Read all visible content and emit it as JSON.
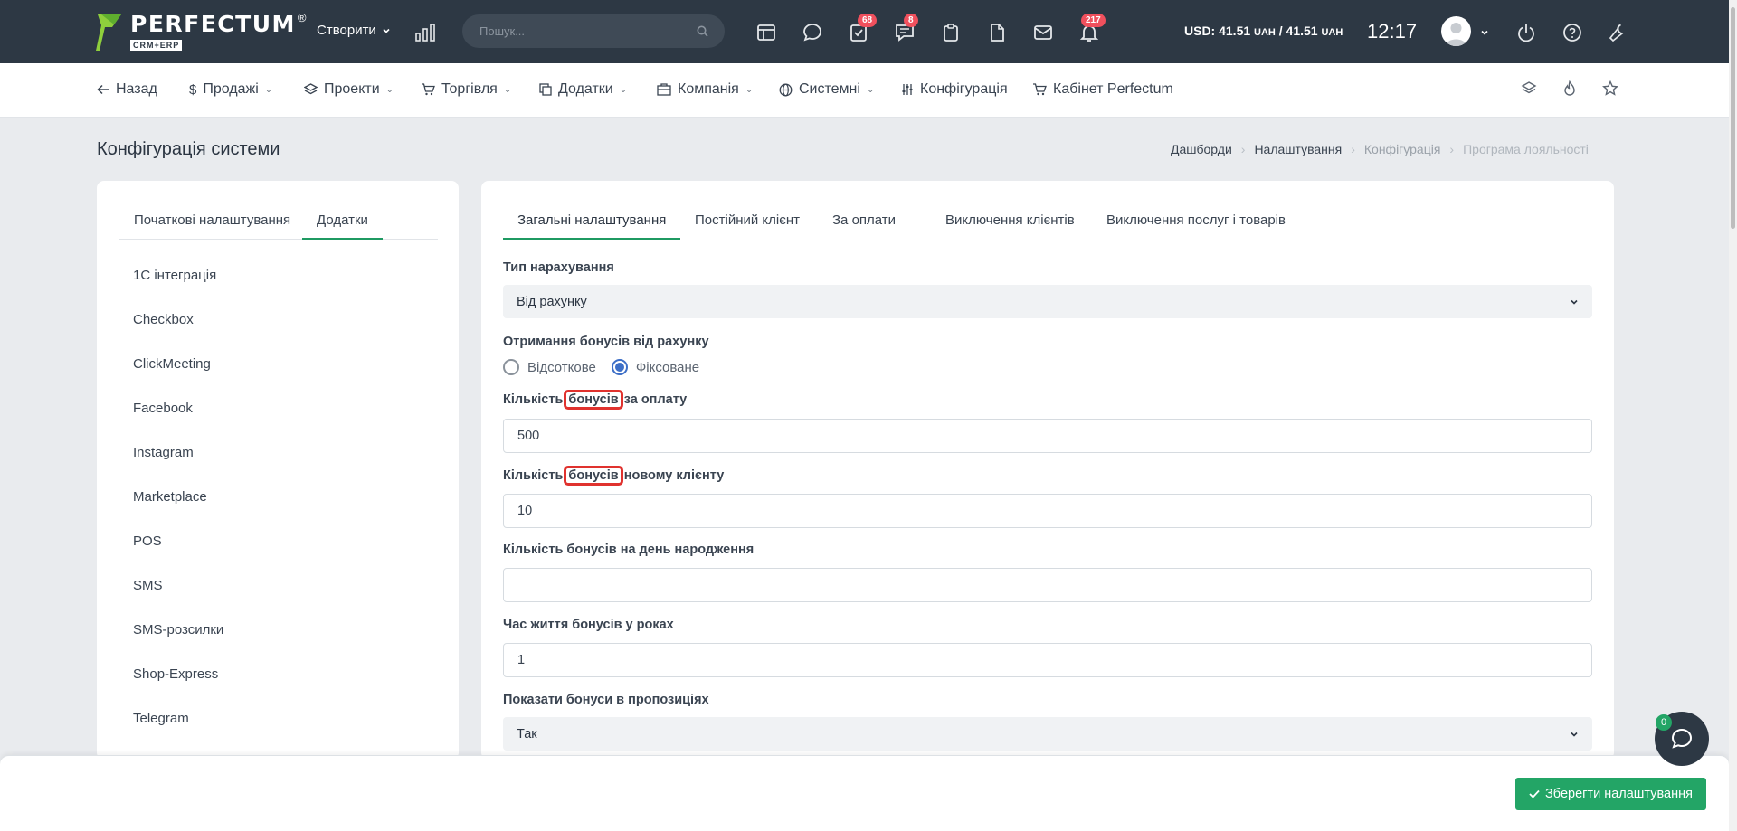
{
  "topbar": {
    "logo_text": "PERFECTUM",
    "logo_sub": "CRM+ERP",
    "logo_reg": "®",
    "create_label": "Створити",
    "search_placeholder": "Пошук...",
    "badges": {
      "tasks": "68",
      "messages": "8",
      "notifications": "217"
    },
    "currency_usd": "USD: 41.51",
    "currency_unit_1": "UAH",
    "currency_sep": " / 41.51",
    "currency_unit_2": "UAH",
    "clock": "12:17"
  },
  "nav": {
    "back": "Назад",
    "sales": "Продажі",
    "projects": "Проекти",
    "trade": "Торгівля",
    "addons": "Додатки",
    "company": "Компанія",
    "system": "Системні",
    "config": "Конфігурація",
    "cabinet": "Кабінет Perfectum"
  },
  "page": {
    "title": "Конфігурація системи",
    "breadcrumb": [
      "Дашборди",
      "Налаштування",
      "Конфігурація",
      "Програма лояльності"
    ]
  },
  "left": {
    "tabs": [
      "Початкові налаштування",
      "Додатки"
    ],
    "items": [
      "1С інтеграція",
      "Checkbox",
      "ClickMeeting",
      "Facebook",
      "Instagram",
      "Marketplace",
      "POS",
      "SMS",
      "SMS-розсилки",
      "Shop-Express",
      "Telegram"
    ]
  },
  "right": {
    "tabs": [
      "Загальні налаштування",
      "Постійний клієнт",
      "За оплати",
      "Виключення клієнтів",
      "Виключення послуг і товарів"
    ],
    "accrual_type_label": "Тип нарахування",
    "accrual_type_value": "Від рахунку",
    "receive_label": "Отримання бонусів від рахунку",
    "radio_percent": "Відсоткове",
    "radio_fixed": "Фіксоване",
    "payment_label_pre": "Кількість ",
    "payment_label_hl": "бонусів",
    "payment_label_post": " за оплату",
    "payment_value": "500",
    "newclient_label_pre": "Кількість ",
    "newclient_label_hl": "бонусів",
    "newclient_label_post": " новому клієнту",
    "newclient_value": "10",
    "birthday_label": "Кількість бонусів на день народження",
    "birthday_value": "",
    "lifetime_label": "Час життя бонусів у роках",
    "lifetime_value": "1",
    "show_label": "Показати бонуси в пропозиціях",
    "show_value": "Так"
  },
  "footer": {
    "save_label": "Зберегти налаштування",
    "chat_badge": "0"
  },
  "colors": {
    "topbar": "#2d3844",
    "accent_green": "#23a566",
    "badge_red": "#f0505d",
    "highlight_red": "#e0322e",
    "radio_blue": "#3d6fc7"
  }
}
